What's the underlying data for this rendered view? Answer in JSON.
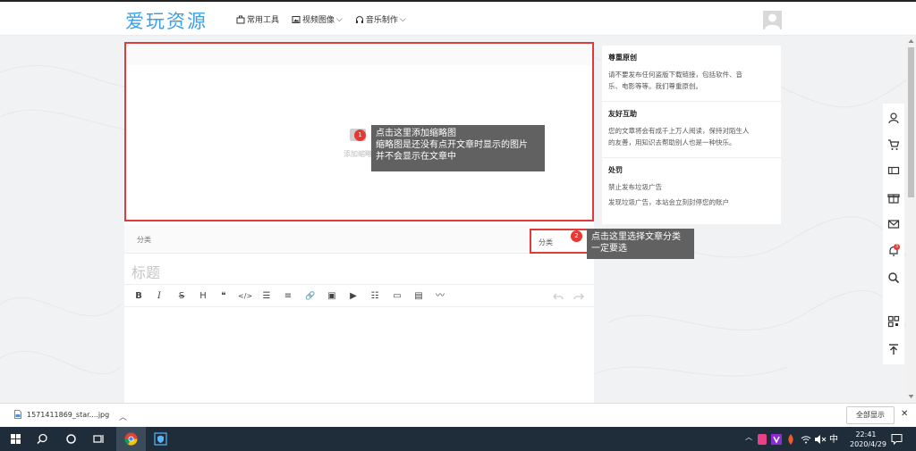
{
  "header": {
    "logo": "爱玩资源",
    "nav": [
      {
        "label": "常用工具",
        "icon": "toolbox-icon",
        "dropdown": false
      },
      {
        "label": "视频图像",
        "icon": "image-icon",
        "dropdown": true
      },
      {
        "label": "音乐制作",
        "icon": "headphones-icon",
        "dropdown": true
      }
    ]
  },
  "editor": {
    "thumbnail_label": "添加缩略图",
    "category_label": "分类",
    "category_select": "分类",
    "title_placeholder": "标题",
    "toolbar": [
      "B",
      "I",
      "S",
      "H",
      "❝",
      "</>",
      "☰",
      "≡",
      "🔗",
      "▣",
      "▶",
      "☷",
      "▭",
      "▤",
      "〰"
    ]
  },
  "tips": {
    "tip1": {
      "badge": "1",
      "line1": "点击这里添加缩略图",
      "line2": "缩略图是还没有点开文章时显示的图片",
      "line3": "并不会显示在文章中"
    },
    "tip2": {
      "badge": "2",
      "line1": "点击这里选择文章分类",
      "line2": "一定要选"
    }
  },
  "sidebar": {
    "sections": [
      {
        "title": "尊重原创",
        "lines": [
          "请不要发布任何盗版下载链接，包括软件、音",
          "乐、电影等等。我们尊重原创。"
        ]
      },
      {
        "title": "友好互助",
        "lines": [
          "您的文章将会有成千上万人阅读，保持对陌生人",
          "的友善，用知识去帮助别人也是一种快乐。"
        ]
      },
      {
        "title": "处罚",
        "lines": [
          "禁止发布垃圾广告",
          "发现垃圾广告，本站会立刻封停您的账户"
        ]
      }
    ]
  },
  "floatbar": {
    "notification_count": "3"
  },
  "download_bar": {
    "file_name": "1571411869_star....jpg",
    "show_all": "全部显示"
  },
  "taskbar": {
    "time": "22:41",
    "date": "2020/4/29",
    "ime": "中"
  },
  "colors": {
    "accent": "#3aa0e6",
    "highlight": "#e03b3b",
    "tooltip": "#616161"
  }
}
